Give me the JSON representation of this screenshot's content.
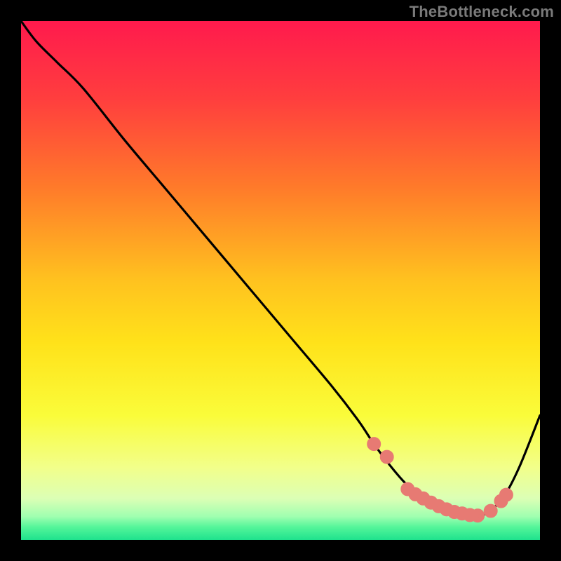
{
  "watermark": "TheBottleneck.com",
  "colors": {
    "background": "#000000",
    "curve": "#000000",
    "marker": "#e77a73",
    "gradient_stops": [
      {
        "offset": 0.0,
        "color": "#ff1a4d"
      },
      {
        "offset": 0.15,
        "color": "#ff3e3e"
      },
      {
        "offset": 0.32,
        "color": "#ff7a2a"
      },
      {
        "offset": 0.5,
        "color": "#ffc21f"
      },
      {
        "offset": 0.62,
        "color": "#ffe21a"
      },
      {
        "offset": 0.76,
        "color": "#fafc3a"
      },
      {
        "offset": 0.86,
        "color": "#f2ff8a"
      },
      {
        "offset": 0.92,
        "color": "#dcffb5"
      },
      {
        "offset": 0.955,
        "color": "#9fffb0"
      },
      {
        "offset": 0.975,
        "color": "#55f59a"
      },
      {
        "offset": 1.0,
        "color": "#1ee28d"
      }
    ]
  },
  "chart_data": {
    "type": "line",
    "title": "",
    "xlabel": "",
    "ylabel": "",
    "xlim": [
      0,
      100
    ],
    "ylim": [
      0,
      100
    ],
    "grid": false,
    "series": [
      {
        "name": "curve",
        "x": [
          0,
          3,
          7,
          12,
          20,
          28,
          36,
          44,
          52,
          60,
          65,
          68,
          71,
          74,
          77,
          80,
          83,
          86,
          88,
          90,
          93,
          96,
          100
        ],
        "y": [
          100,
          96,
          92,
          87,
          77,
          67.5,
          58,
          48.5,
          39,
          29.5,
          23,
          18.5,
          14.5,
          11,
          8.3,
          6.3,
          5.2,
          4.7,
          4.7,
          5.3,
          8.3,
          14,
          24
        ]
      }
    ],
    "markers": {
      "name": "highlighted-points",
      "x": [
        68,
        70.5,
        74.5,
        76,
        77.5,
        79,
        80.5,
        82,
        83.5,
        85,
        86.5,
        88,
        90.5,
        92.5,
        93.5
      ],
      "y": [
        18.5,
        16.0,
        9.8,
        8.8,
        8.0,
        7.2,
        6.5,
        5.9,
        5.4,
        5.1,
        4.8,
        4.7,
        5.6,
        7.5,
        8.7
      ]
    }
  }
}
